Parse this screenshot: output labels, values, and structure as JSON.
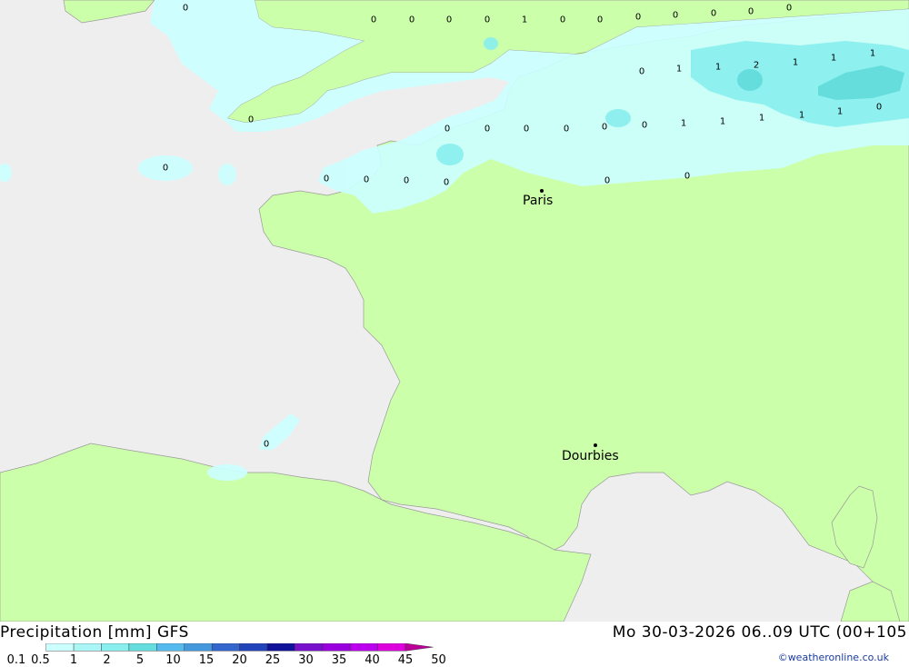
{
  "title": "Precipitation [mm] GFS",
  "datetime": "Mo 30-03-2026 06..09 UTC (00+105",
  "credit": "©weatheronline.co.uk",
  "colors": {
    "sea": "#eeeeee",
    "land": "#ccffaa",
    "border": "#999999"
  },
  "cities": [
    {
      "name": "Paris"
    },
    {
      "name": "Dourbies"
    }
  ],
  "grid_values": [
    "0",
    "0",
    "0",
    "0",
    "0",
    "1",
    "0",
    "0",
    "0",
    "0",
    "0",
    "0",
    "0",
    "0",
    "1",
    "1",
    "2",
    "1",
    "1",
    "1",
    "0",
    "0",
    "0",
    "0",
    "0",
    "0",
    "0",
    "1",
    "1",
    "1",
    "1",
    "1",
    "0",
    "0",
    "0",
    "0",
    "0",
    "0",
    "0",
    "0"
  ],
  "legend": [
    {
      "label": "0.1",
      "color": "#ccffff"
    },
    {
      "label": "0.5",
      "color": "#aaf5f5"
    },
    {
      "label": "1",
      "color": "#88eeee"
    },
    {
      "label": "2",
      "color": "#66dddd"
    },
    {
      "label": "5",
      "color": "#55bbee"
    },
    {
      "label": "10",
      "color": "#4499dd"
    },
    {
      "label": "15",
      "color": "#3366cc"
    },
    {
      "label": "20",
      "color": "#2244bb"
    },
    {
      "label": "25",
      "color": "#111199"
    },
    {
      "label": "30",
      "color": "#7711cc"
    },
    {
      "label": "35",
      "color": "#9900dd"
    },
    {
      "label": "40",
      "color": "#bb00ee"
    },
    {
      "label": "45",
      "color": "#dd00dd"
    },
    {
      "label": "50",
      "color": "#bb0099"
    }
  ]
}
